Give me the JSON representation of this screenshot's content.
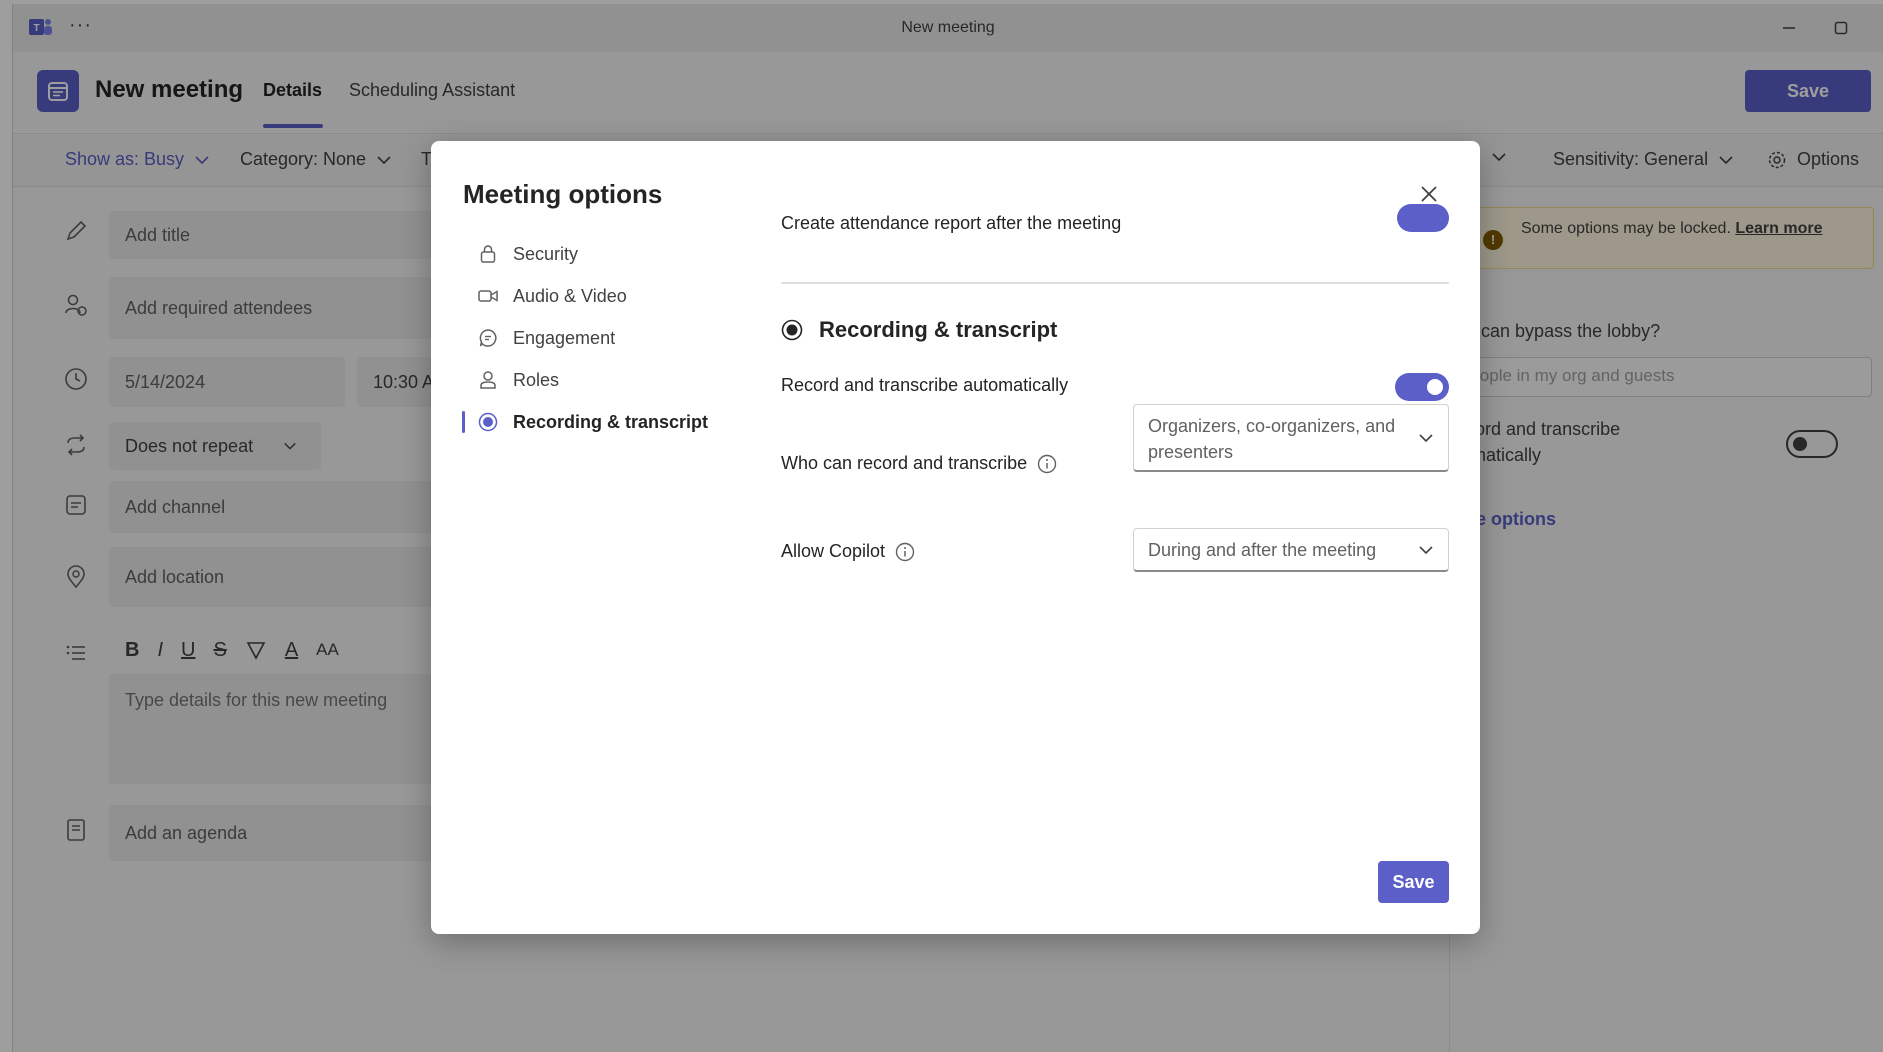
{
  "window": {
    "title": "New meeting",
    "more_glyph": "···"
  },
  "header": {
    "title": "New meeting",
    "tabs": [
      {
        "label": "Details",
        "active": true
      },
      {
        "label": "Scheduling Assistant",
        "active": false
      }
    ],
    "save_label": "Save"
  },
  "toolbar": {
    "show_as": "Show as: Busy",
    "category": "Category: None",
    "truncated": "T",
    "sensitivity": "Sensitivity: General",
    "options": "Options"
  },
  "form": {
    "title_placeholder": "Add title",
    "attendees_placeholder": "Add required attendees",
    "date": "5/14/2024",
    "time": "10:30 A",
    "repeat": "Does not repeat",
    "channel_placeholder": "Add channel",
    "location_placeholder": "Add location",
    "details_placeholder": "Type details for this new meeting",
    "agenda_placeholder": "Add an agenda",
    "format_buttons": [
      "B",
      "I",
      "U",
      "S",
      "A",
      "AA"
    ]
  },
  "right_panel": {
    "warning_text": "Some options may be locked.",
    "warning_link": "Learn more",
    "lobby_label": "ho can bypass the lobby?",
    "lobby_value": "People in my org and guests",
    "record_label_line1": "ecord and transcribe",
    "record_label_line2": "tomatically",
    "more_options": "ore options"
  },
  "dialog": {
    "title": "Meeting options",
    "nav": [
      {
        "label": "Security",
        "icon": "lock-icon",
        "active": false
      },
      {
        "label": "Audio & Video",
        "icon": "video-icon",
        "active": false
      },
      {
        "label": "Engagement",
        "icon": "chat-icon",
        "active": false
      },
      {
        "label": "Roles",
        "icon": "person-icon",
        "active": false
      },
      {
        "label": "Recording & transcript",
        "icon": "record-icon",
        "active": true
      }
    ],
    "cut_off_row": "Create attendance report after the meeting",
    "section_title": "Recording & transcript",
    "record_auto_label": "Record and transcribe automatically",
    "record_auto_on": true,
    "who_can_record_label": "Who can record and transcribe",
    "who_can_record_value": "Organizers, co-organizers, and presenters",
    "copilot_label": "Allow Copilot",
    "copilot_value": "During and after the meeting",
    "save_label": "Save"
  },
  "colors": {
    "accent": "#5b5fc7",
    "overlay": "rgba(0,0,0,0.38)"
  }
}
